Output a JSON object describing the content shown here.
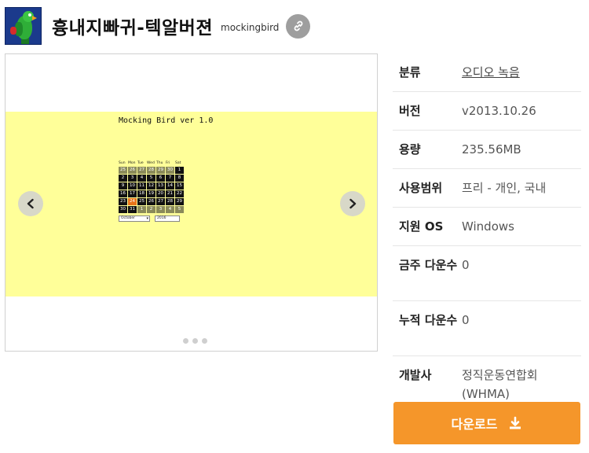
{
  "header": {
    "title": "흉내지빠귀-텍알버젼",
    "subtitle": "mockingbird"
  },
  "slide": {
    "caption": "Mocking Bird ver 1.0",
    "calendar": {
      "weekdays": [
        "Sun",
        "Mon",
        "Tue",
        "Wed",
        "Thu",
        "Fri",
        "Sat"
      ],
      "days": [
        "25",
        "26",
        "27",
        "28",
        "29",
        "30",
        "1",
        "2",
        "3",
        "4",
        "5",
        "6",
        "7",
        "8",
        "9",
        "10",
        "11",
        "12",
        "13",
        "14",
        "15",
        "16",
        "17",
        "18",
        "19",
        "20",
        "21",
        "22",
        "23",
        "24",
        "25",
        "26",
        "27",
        "28",
        "29",
        "30",
        "31",
        "1",
        "2",
        "3",
        "4",
        "5"
      ],
      "month": "October",
      "year": "2016"
    }
  },
  "info": {
    "category_label": "분류",
    "category_value": "오디오 녹음",
    "version_label": "버전",
    "version_value": "v2013.10.26",
    "size_label": "용량",
    "size_value": "235.56MB",
    "license_label": "사용범위",
    "license_value": "프리 - 개인, 국내",
    "os_label": "지원 OS",
    "os_value": "Windows",
    "weekly_label": "금주 다운수",
    "weekly_value": "0",
    "total_label": "누적 다운수",
    "total_value": "0",
    "developer_label": "개발사",
    "developer_value": "정직운동연합회(WHMA)"
  },
  "download": {
    "label": "다운로드"
  },
  "colors": {
    "accent": "#f5962a",
    "slide_bg": "#ffff99"
  },
  "icons": {
    "link": "link-icon",
    "download": "download-icon",
    "prev": "chevron-left-icon",
    "next": "chevron-right-icon"
  }
}
